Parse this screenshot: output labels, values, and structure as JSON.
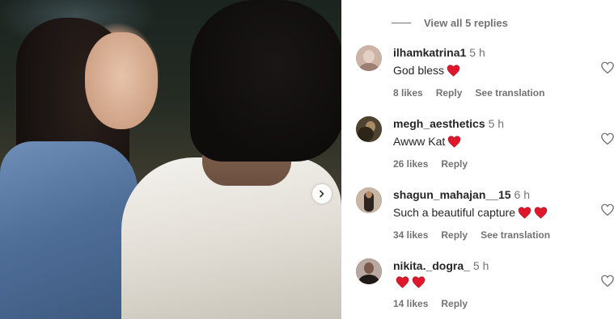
{
  "thread": {
    "view_replies_label": "View all 5 replies"
  },
  "comments": [
    {
      "username": "ilhamkatrina1",
      "time": "5 h",
      "text": "God bless",
      "hearts": 1,
      "likes": "8 likes",
      "reply": "Reply",
      "translation": "See translation",
      "avatar_color": "#b89a8c"
    },
    {
      "username": "megh_aesthetics",
      "time": "5 h",
      "text": "Awww Kat",
      "hearts": 1,
      "likes": "26 likes",
      "reply": "Reply",
      "translation": "",
      "avatar_color": "#6b5a3e"
    },
    {
      "username": "shagun_mahajan__15",
      "time": "6 h",
      "text": "Such a beautiful capture",
      "hearts": 2,
      "likes": "34 likes",
      "reply": "Reply",
      "translation": "See translation",
      "avatar_color": "#8a6a55"
    },
    {
      "username": "nikita._dogra_",
      "time": "5 h",
      "text": "",
      "hearts": 2,
      "likes": "14 likes",
      "reply": "Reply",
      "translation": "",
      "avatar_color": "#3a2e2a"
    }
  ],
  "colors": {
    "heart_emoji": "#e0162b",
    "muted_text": "#737373",
    "primary_text": "#262626"
  },
  "icons": {
    "next": "chevron-right-icon",
    "like": "heart-outline-icon",
    "emoji": "red-heart-emoji"
  }
}
